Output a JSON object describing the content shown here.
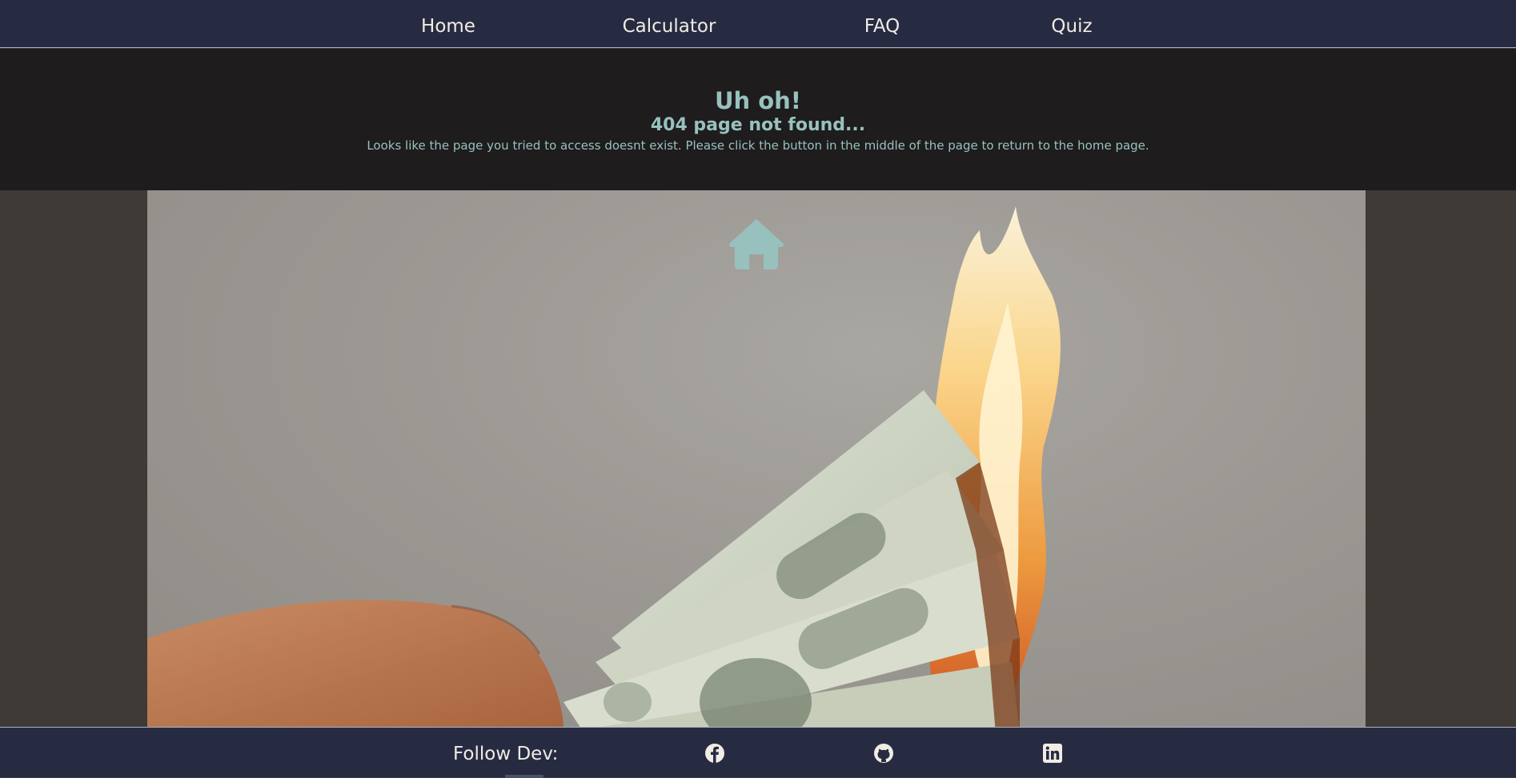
{
  "nav": {
    "items": [
      {
        "label": "Home"
      },
      {
        "label": "Calculator"
      },
      {
        "label": "FAQ"
      },
      {
        "label": "Quiz"
      }
    ]
  },
  "hero": {
    "title": "Uh oh!",
    "subtitle": "404 page not found...",
    "message": "Looks like the page you tried to access doesnt exist. Please click the button in the middle of the page to return to the home page."
  },
  "home_button": {
    "icon": "home-icon",
    "color": "#98c1be"
  },
  "footer": {
    "label": "Follow Dev:",
    "social": [
      {
        "icon": "facebook-icon"
      },
      {
        "icon": "github-icon"
      },
      {
        "icon": "linkedin-icon"
      }
    ]
  },
  "colors": {
    "nav_bg": "#272b42",
    "hero_bg": "#1e1c1d",
    "accent": "#98c1be",
    "text_light": "#f1ece4",
    "page_bg": "#3f3a36"
  }
}
